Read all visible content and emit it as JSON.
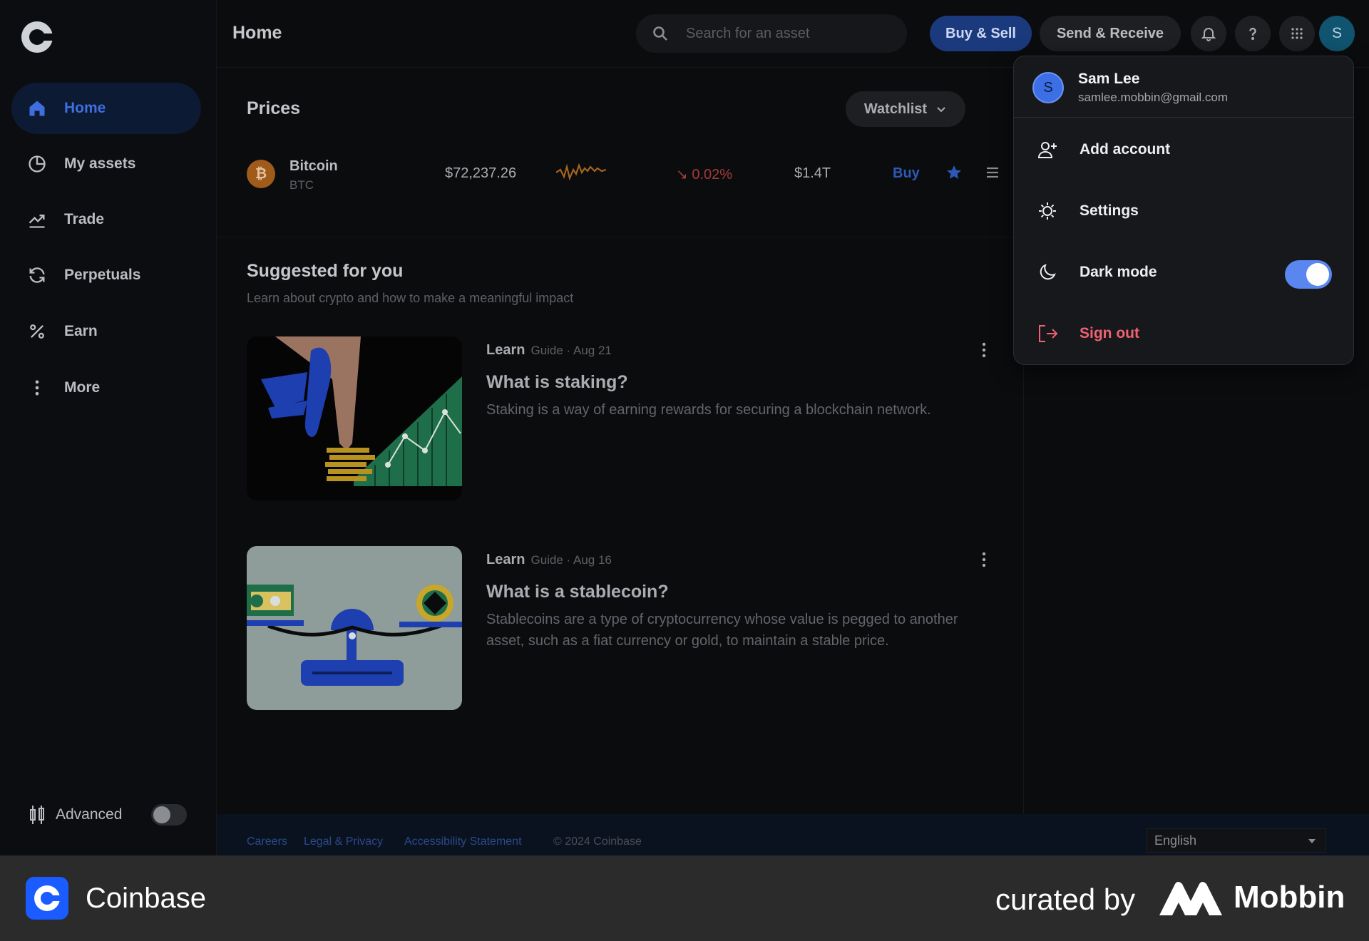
{
  "header": {
    "title": "Home",
    "search_placeholder": "Search for an asset",
    "buy_sell_label": "Buy & Sell",
    "send_receive_label": "Send & Receive",
    "avatar_initial": "S"
  },
  "sidebar": {
    "items": [
      {
        "label": "Home",
        "icon": "home-icon",
        "active": true
      },
      {
        "label": "My assets",
        "icon": "pie-chart-icon"
      },
      {
        "label": "Trade",
        "icon": "trend-icon"
      },
      {
        "label": "Perpetuals",
        "icon": "refresh-icon"
      },
      {
        "label": "Earn",
        "icon": "percent-icon"
      },
      {
        "label": "More",
        "icon": "more-vertical-icon"
      }
    ],
    "advanced_label": "Advanced",
    "advanced_on": false
  },
  "prices": {
    "title": "Prices",
    "watchlist_label": "Watchlist",
    "rows": [
      {
        "name": "Bitcoin",
        "symbol": "BTC",
        "coin_glyph": "₿",
        "price": "$72,237.26",
        "change": "↘ 0.02%",
        "market_cap": "$1.4T",
        "buy_label": "Buy"
      }
    ]
  },
  "suggested": {
    "title": "Suggested for you",
    "subtitle": "Learn about crypto and how to make a meaningful impact",
    "cards": [
      {
        "category": "Learn",
        "meta": "Guide · Aug 21",
        "title": "What is staking?",
        "description": "Staking is a way of earning rewards for securing a blockchain network."
      },
      {
        "category": "Learn",
        "meta": "Guide · Aug 16",
        "title": "What is a stablecoin?",
        "description": "Stablecoins are a type of cryptocurrency whose value is pegged to another asset, such as a fiat currency or gold, to maintain a stable price."
      }
    ]
  },
  "footer": {
    "links": [
      "Careers",
      "Legal & Privacy",
      "Accessibility Statement"
    ],
    "copyright": "© 2024 Coinbase",
    "language": "English"
  },
  "account_menu": {
    "avatar_initial": "S",
    "name": "Sam Lee",
    "email": "samlee.mobbin@gmail.com",
    "items": [
      {
        "label": "Add account",
        "icon": "add-user-icon"
      },
      {
        "label": "Settings",
        "icon": "gear-icon"
      },
      {
        "label": "Dark mode",
        "icon": "moon-icon",
        "toggle_on": true
      },
      {
        "label": "Sign out",
        "icon": "sign-out-icon",
        "danger": true
      }
    ]
  },
  "brand_bar": {
    "app_name": "Coinbase",
    "curated_by": "curated by",
    "curator": "Mobbin"
  },
  "colors": {
    "accent_blue": "#3e6fe0",
    "danger": "#f06272",
    "negative_change": "#a33b3b",
    "coinbase_blue": "#1a5cff"
  }
}
